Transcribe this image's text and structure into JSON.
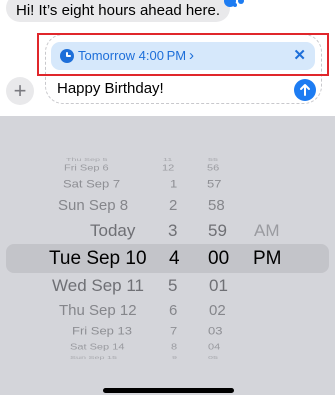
{
  "conversation": {
    "received_message": "Hi! It’s eight hours ahead here."
  },
  "compose": {
    "scheduled_send_label": "Tomorrow 4:00 PM",
    "message_text": "Happy Birthday!",
    "icons": {
      "schedule": "clock-icon",
      "chevron": "chevron-right-icon",
      "cancel": "close-icon",
      "add": "plus-icon",
      "send": "arrow-up-icon"
    }
  },
  "picker": {
    "date_column": [
      "Thu Sep 5",
      "Fri Sep 6",
      "Sat Sep 7",
      "Sun Sep 8",
      "Today",
      "Tue Sep 10",
      "Wed Sep 11",
      "Thu Sep 12",
      "Fri Sep 13",
      "Sat Sep 14",
      "Sun Sep 15"
    ],
    "hour_column": [
      "11",
      "12",
      "1",
      "2",
      "3",
      "4",
      "5",
      "6",
      "7",
      "8",
      "9"
    ],
    "minute_column": [
      "55",
      "56",
      "57",
      "58",
      "59",
      "00",
      "01",
      "02",
      "03",
      "04",
      "05"
    ],
    "ampm_column": [
      "AM",
      "PM"
    ],
    "selected": {
      "date": "Tue Sep 10",
      "hour": "4",
      "minute": "00",
      "period": "PM"
    }
  },
  "colors": {
    "accent": "#1d7cf2",
    "highlight_border": "#e0262b",
    "picker_background": "#d4d5da"
  }
}
